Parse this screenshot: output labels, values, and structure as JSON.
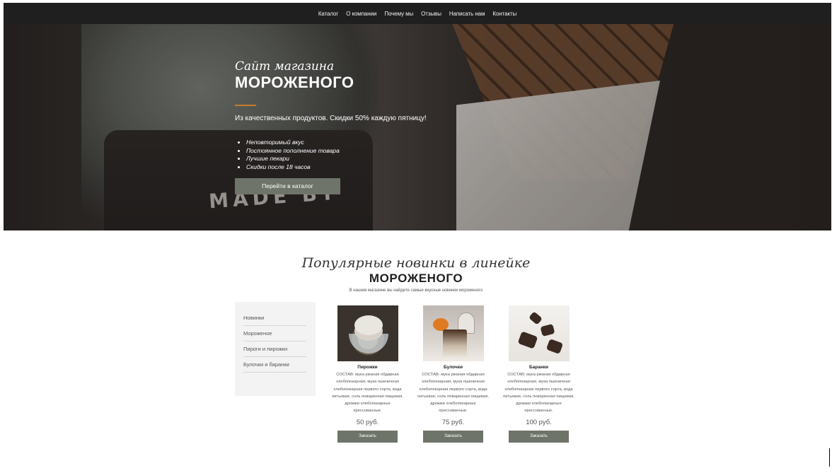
{
  "nav": {
    "items": [
      "Каталог",
      "О компании",
      "Почему мы",
      "Отзывы",
      "Написать нам",
      "Контакты"
    ]
  },
  "hero": {
    "kicker": "Сайт магазина",
    "title": "МОРОЖЕНОГО",
    "subtitle": "Из качественных продуктов. Скидки 50% каждую пятницу!",
    "features": [
      "Неповторимый вкус",
      "Постоянное пополнение товара",
      "Лучшие пекари",
      "Скидки после 18 часов"
    ],
    "button_label": "Перейти в каталог",
    "image_text": "MADE BY"
  },
  "section": {
    "kicker": "Популярные новинки в линейке",
    "title": "МОРОЖЕНОГО",
    "subtitle": "В нашем магазине вы найдете самые вкусные новинки мороженого"
  },
  "sidebar": {
    "items": [
      "Новинки",
      "Мороженое",
      "Пироги и пирожки",
      "Булочки и баранки"
    ]
  },
  "products": [
    {
      "name": "Пирожки",
      "description": "СОСТАВ: мука ржаная обдирная хлебопекарная, мука пшеничная хлебопекарная первого сорта, вода питьевая, соль поваренная пищевая, дрожжи хлебопекарные прессованные.",
      "price": "50 руб.",
      "button_label": "Заказать"
    },
    {
      "name": "Булочки",
      "description": "СОСТАВ: мука ржаная обдирная хлебопекарная, мука пшеничная хлебопекарная первого сорта, вода питьевая, соль поваренная пищевая, дрожжи хлебопекарные прессованные.",
      "price": "75 руб.",
      "button_label": "Заказать"
    },
    {
      "name": "Баранки",
      "description": "СОСТАВ: мука ржаная обдирная хлебопекарная, мука пшеничная хлебопекарная первого сорта, вода питьевая, соль поваренная пищевая, дрожжи хлебопекарные прессованные.",
      "price": "100 руб.",
      "button_label": "Заказать"
    }
  ],
  "colors": {
    "topbar": "#1f1f1f",
    "accent_button": "#6e7469",
    "hero_rule": "#c77c2e",
    "sidebar_bg": "#f3f3f3"
  }
}
